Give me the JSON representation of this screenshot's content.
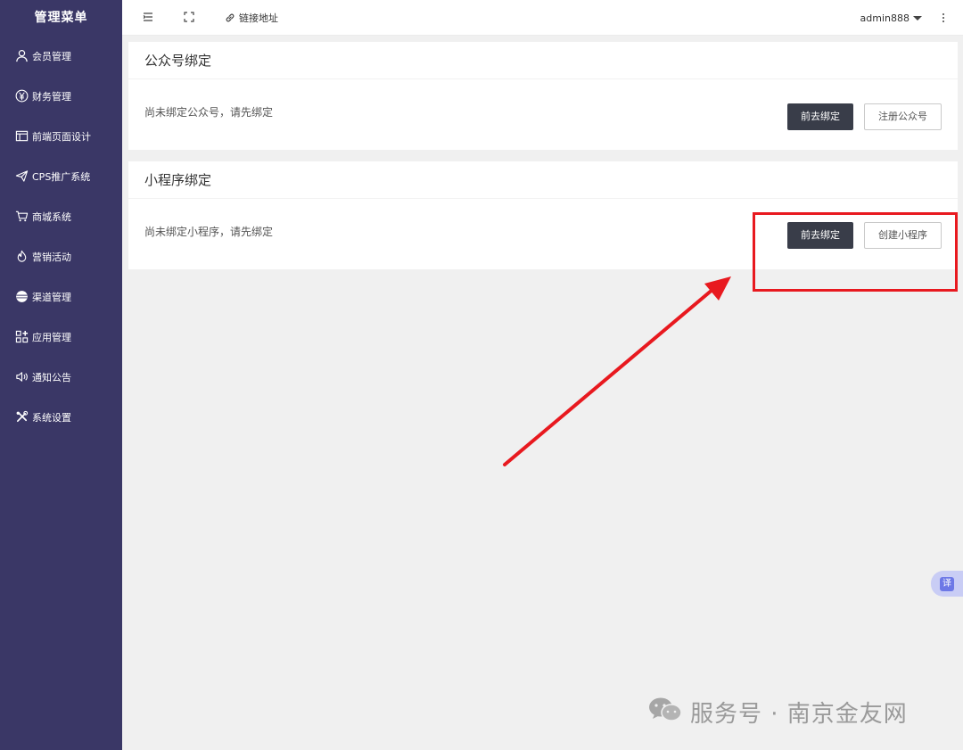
{
  "sidebar": {
    "title": "管理菜单",
    "items": [
      {
        "label": "会员管理",
        "icon": "user-icon"
      },
      {
        "label": "财务管理",
        "icon": "yen-icon"
      },
      {
        "label": "前端页面设计",
        "icon": "layout-icon"
      },
      {
        "label": "CPS推广系统",
        "icon": "paper-plane-icon"
      },
      {
        "label": "商城系统",
        "icon": "cart-icon"
      },
      {
        "label": "营销活动",
        "icon": "fire-icon"
      },
      {
        "label": "渠道管理",
        "icon": "globe-icon"
      },
      {
        "label": "应用管理",
        "icon": "apps-icon"
      },
      {
        "label": "通知公告",
        "icon": "speaker-icon"
      },
      {
        "label": "系统设置",
        "icon": "tools-icon"
      }
    ]
  },
  "topbar": {
    "link_label": "链接地址",
    "user": "admin888"
  },
  "cards": [
    {
      "title": "公众号绑定",
      "text": "尚未绑定公众号，请先绑定",
      "primary": "前去绑定",
      "secondary": "注册公众号"
    },
    {
      "title": "小程序绑定",
      "text": "尚未绑定小程序，请先绑定",
      "primary": "前去绑定",
      "secondary": "创建小程序"
    }
  ],
  "translate_label": "译",
  "watermark": "服务号 · 南京金友网",
  "colors": {
    "sidebar_bg": "#3a3766",
    "dark_button": "#393d49",
    "annotation_red": "#e8191f"
  }
}
